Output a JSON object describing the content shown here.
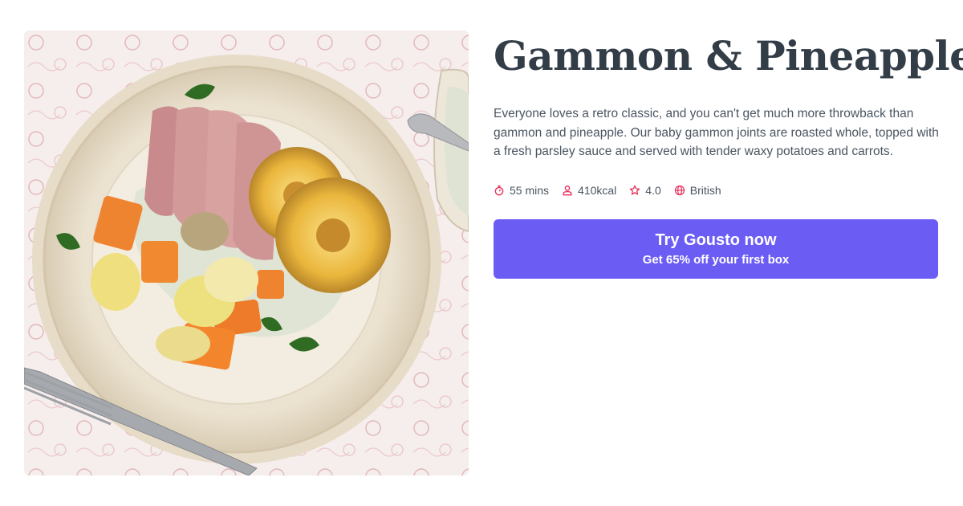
{
  "recipe": {
    "title": "Gammon & Pineapple",
    "description": "Everyone loves a retro classic, and you can't get much more throwback than gammon and pineapple. Our baby gammon joints are roasted whole, topped with a fresh parsley sauce and served with tender waxy potatoes and carrots.",
    "meta": {
      "time": "55 mins",
      "calories": "410kcal",
      "rating": "4.0",
      "cuisine": "British"
    }
  },
  "cta": {
    "label": "Try Gousto now",
    "sublabel": "Get 65% off your first box"
  },
  "icons": {
    "time": "stopwatch-icon",
    "calories": "person-icon",
    "rating": "star-icon",
    "cuisine": "globe-icon"
  },
  "colors": {
    "accent": "#6b5cf4",
    "icon": "#e8315c",
    "text": "#333d47"
  }
}
